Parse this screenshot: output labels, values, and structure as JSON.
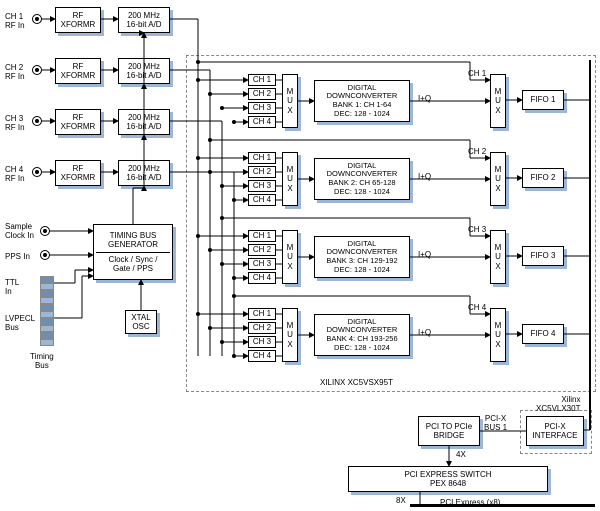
{
  "inputs": {
    "ch1": "CH 1\nRF In",
    "ch2": "CH 2\nRF In",
    "ch3": "CH 3\nRF In",
    "ch4": "CH 4\nRF In",
    "sample_clk": "Sample\nClock In",
    "pps": "PPS In",
    "ttl": "TTL\nIn",
    "lvpecl": "LVPECL\nBus",
    "tbus": "Timing\nBus"
  },
  "rf_xformr": "RF\nXFORMR",
  "adc": "200 MHz\n16-bit A/D",
  "timing_gen": {
    "title": "TIMING BUS\nGENERATOR",
    "sub": "Clock / Sync /\nGate / PPS"
  },
  "xtal": "XTAL\nOSC",
  "mux_in": {
    "ch1": "CH 1",
    "ch2": "CH 2",
    "ch3": "CH 3",
    "ch4": "CH 4"
  },
  "mux": "M\nU\nX",
  "ddc": {
    "b1": "DIGITAL\nDOWNCONVERTER\nBANK 1: CH 1-64\nDEC: 128 - 1024",
    "b2": "DIGITAL\nDOWNCONVERTER\nBANK 2: CH 65-128\nDEC: 128 - 1024",
    "b3": "DIGITAL\nDOWNCONVERTER\nBANK 3: CH 129-192\nDEC: 128 - 1024",
    "b4": "DIGITAL\nDOWNCONVERTER\nBANK 4: CH 193-256\nDEC: 128 - 1024"
  },
  "iq": "I+Q",
  "out_mux": {
    "ch1": "CH 1",
    "ch2": "CH 2",
    "ch3": "CH 3",
    "ch4": "CH 4"
  },
  "fifo": {
    "f1": "FIFO 1",
    "f2": "FIFO 2",
    "f3": "FIFO 3",
    "f4": "FIFO 4"
  },
  "fpga_ddc": "XILINX XC5VSX95T",
  "fpga_pcix": "Xilinx\nXC5VLX30T",
  "pcix_if": "PCI-X\nINTERFACE",
  "pcix_bus": "PCI-X\nBUS 1",
  "bridge": "PCI TO PCIe\nBRIDGE",
  "switch": "PCI EXPRESS SWITCH\nPEX 8648",
  "lanes": {
    "x4": "4X",
    "x8": "8X"
  },
  "pcie": "PCI Express (x8)"
}
